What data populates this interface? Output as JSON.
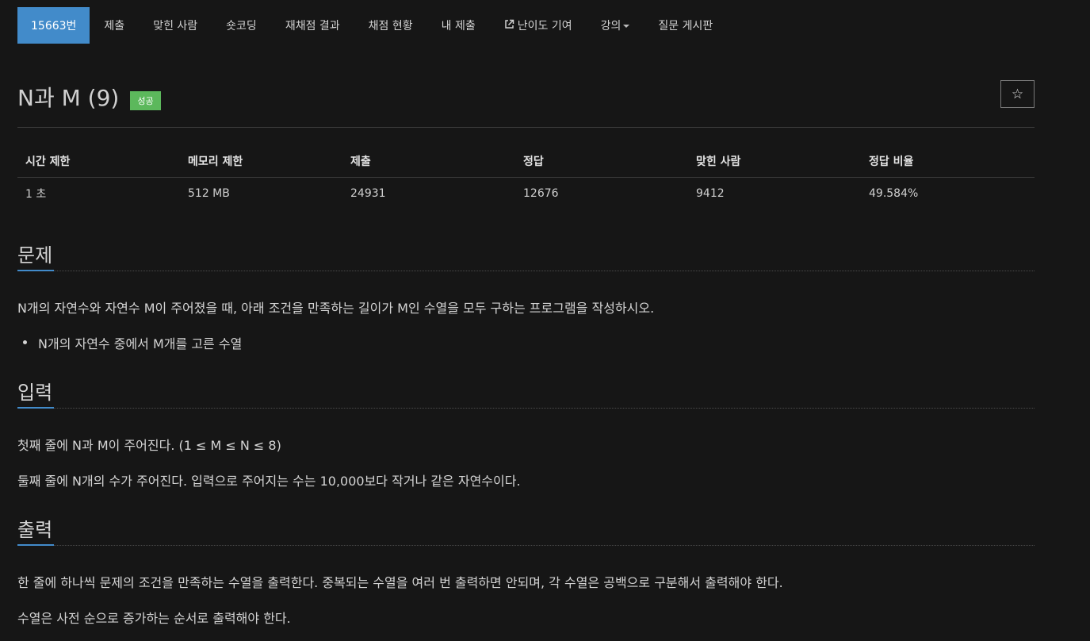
{
  "nav": {
    "items": [
      {
        "label": "15663번",
        "active": true
      },
      {
        "label": "제출"
      },
      {
        "label": "맞힌 사람"
      },
      {
        "label": "숏코딩"
      },
      {
        "label": "재채점 결과"
      },
      {
        "label": "채점 현황"
      },
      {
        "label": "내 제출"
      },
      {
        "label": "난이도 기여",
        "icon": "external-link-icon"
      },
      {
        "label": "강의",
        "icon": "caret-down-icon"
      },
      {
        "label": "질문 게시판"
      }
    ]
  },
  "problem": {
    "title": "N과 M (9)",
    "badge": "성공",
    "star_icon": "☆"
  },
  "info_table": {
    "headers": [
      "시간 제한",
      "메모리 제한",
      "제출",
      "정답",
      "맞힌 사람",
      "정답 비율"
    ],
    "values": [
      "1 초",
      "512 MB",
      "24931",
      "12676",
      "9412",
      "49.584%"
    ]
  },
  "sections": {
    "description": {
      "heading": "문제",
      "paragraph": "N개의 자연수와 자연수 M이 주어졌을 때, 아래 조건을 만족하는 길이가 M인 수열을 모두 구하는 프로그램을 작성하시오.",
      "bullets": [
        "N개의 자연수 중에서 M개를 고른 수열"
      ]
    },
    "input": {
      "heading": "입력",
      "lines": [
        "첫째 줄에 N과 M이 주어진다. (1 ≤ M ≤ N ≤ 8)",
        "둘째 줄에 N개의 수가 주어진다. 입력으로 주어지는 수는 10,000보다 작거나 같은 자연수이다."
      ]
    },
    "output": {
      "heading": "출력",
      "lines": [
        "한 줄에 하나씩 문제의 조건을 만족하는 수열을 출력한다. 중복되는 수열을 여러 번 출력하면 안되며, 각 수열은 공백으로 구분해서 출력해야 한다.",
        "수열은 사전 순으로 증가하는 순서로 출력해야 한다."
      ]
    }
  },
  "colors": {
    "background": "#161616",
    "accent": "#428bca",
    "success": "#5cb85c"
  }
}
